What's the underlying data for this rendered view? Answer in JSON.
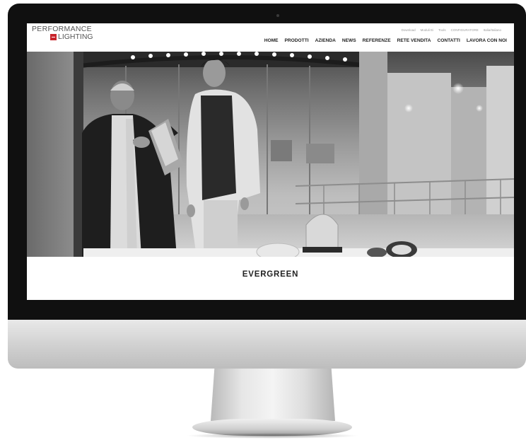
{
  "brand": {
    "line1": "PERFORMANCE",
    "line2": "LIGHTING"
  },
  "utility_nav": [
    "Download",
    "Moduli Ei",
    "Tools",
    "CONFIGURATORE",
    "Italia/Italiano"
  ],
  "main_nav": [
    "HOME",
    "PRODOTTI",
    "AZIENDA",
    "NEWS",
    "REFERENZE",
    "RETE VENDITA",
    "CONTATTI",
    "LAVORA CON NOI"
  ],
  "hero": {
    "caption": "EVERGREEN"
  },
  "colors": {
    "brand_red": "#c8242c",
    "bezel": "#101010",
    "nav_text": "#222222"
  }
}
